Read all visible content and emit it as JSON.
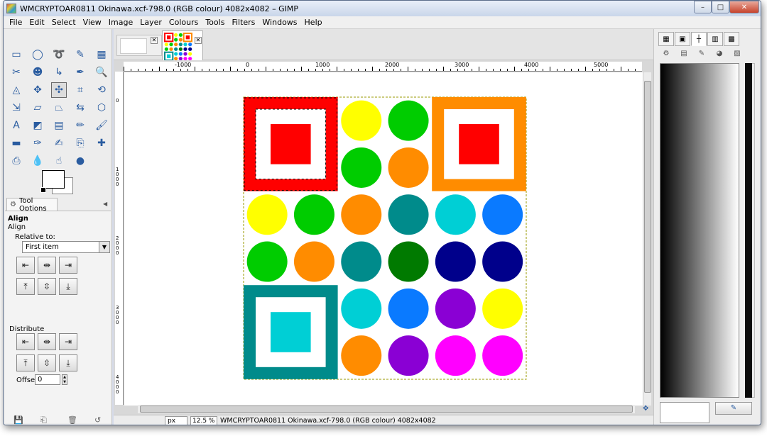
{
  "window": {
    "title": "WMCRYPTOAR0811 Okinawa.xcf-798.0 (RGB colour) 4082x4082 – GIMP",
    "minimize": "–",
    "maximize": "□",
    "close": "✕"
  },
  "menu": [
    "File",
    "Edit",
    "Select",
    "View",
    "Image",
    "Layer",
    "Colours",
    "Tools",
    "Filters",
    "Windows",
    "Help"
  ],
  "toolbox": {
    "tools": [
      {
        "name": "rect-select-icon",
        "glyph": "▭"
      },
      {
        "name": "ellipse-select-icon",
        "glyph": "◯"
      },
      {
        "name": "free-select-icon",
        "glyph": "➰"
      },
      {
        "name": "fuzzy-select-icon",
        "glyph": "✎"
      },
      {
        "name": "select-by-color-icon",
        "glyph": "▦"
      },
      {
        "name": "scissors-select-icon",
        "glyph": "✂"
      },
      {
        "name": "foreground-select-icon",
        "glyph": "☻"
      },
      {
        "name": "paths-icon",
        "glyph": "↳"
      },
      {
        "name": "color-picker-icon",
        "glyph": "✒"
      },
      {
        "name": "zoom-icon",
        "glyph": "🔍"
      },
      {
        "name": "measure-icon",
        "glyph": "◬"
      },
      {
        "name": "move-icon",
        "glyph": "✥"
      },
      {
        "name": "align-icon",
        "glyph": "✣"
      },
      {
        "name": "crop-icon",
        "glyph": "⌗"
      },
      {
        "name": "rotate-icon",
        "glyph": "⟲"
      },
      {
        "name": "scale-icon",
        "glyph": "⇲"
      },
      {
        "name": "shear-icon",
        "glyph": "▱"
      },
      {
        "name": "perspective-icon",
        "glyph": "⏢"
      },
      {
        "name": "flip-icon",
        "glyph": "⇆"
      },
      {
        "name": "cage-icon",
        "glyph": "⬡"
      },
      {
        "name": "text-icon",
        "glyph": "A"
      },
      {
        "name": "bucket-fill-icon",
        "glyph": "◩"
      },
      {
        "name": "blend-icon",
        "glyph": "▤"
      },
      {
        "name": "pencil-icon",
        "glyph": "✏"
      },
      {
        "name": "paintbrush-icon",
        "glyph": "🖌"
      },
      {
        "name": "eraser-icon",
        "glyph": "▬"
      },
      {
        "name": "airbrush-icon",
        "glyph": "✑"
      },
      {
        "name": "ink-icon",
        "glyph": "✍"
      },
      {
        "name": "clone-icon",
        "glyph": "⎘"
      },
      {
        "name": "heal-icon",
        "glyph": "✚"
      },
      {
        "name": "perspective-clone-icon",
        "glyph": "⎙"
      },
      {
        "name": "blur-icon",
        "glyph": "💧"
      },
      {
        "name": "smudge-icon",
        "glyph": "☝"
      },
      {
        "name": "dodge-burn-icon",
        "glyph": "●"
      }
    ],
    "active_tool": 12,
    "tab_label": "Tool Options",
    "options": {
      "title": "Align",
      "subtitle": "Align",
      "relative_label": "Relative to:",
      "relative_value": "First item",
      "distribute_label": "Distribute",
      "offset_label": "Offset:",
      "offset_value": "0",
      "align_buttons": [
        "⇤",
        "⇹",
        "⇥"
      ],
      "align_buttons_v": [
        "⤒",
        "⇳",
        "⤓"
      ]
    },
    "bottom_icons": [
      "💾",
      "⎗",
      "🗑",
      "↺"
    ]
  },
  "image_tabs": {
    "tab1_close": "✕",
    "tab2_close": "✕"
  },
  "rulers": {
    "h_labels": [
      "-1000",
      "0",
      "1000",
      "2000",
      "3000",
      "4000",
      "5000"
    ],
    "v_labels": [
      "0",
      "1000",
      "2000",
      "3000",
      "4000"
    ]
  },
  "statusbar": {
    "unit": "px",
    "zoom": "12.5 %",
    "text": "WMCRYPTOAR0811 Okinawa.xcf-798.0 (RGB colour) 4082x4082"
  },
  "colors": {
    "red": "#ff0000",
    "orange": "#ff8c00",
    "yellow": "#ffff00",
    "green": "#00cc00",
    "teal": "#008b8b",
    "dark_green": "#007a00",
    "cyan": "#00cfd5",
    "blue": "#0a7aff",
    "navy": "#00008b",
    "purple": "#8a00d4",
    "magenta": "#ff00ff",
    "white": "#ffffff"
  },
  "artwork": {
    "squares": [
      {
        "cell": [
          0,
          0
        ],
        "outer": "red",
        "inner": "red"
      },
      {
        "cell": [
          4,
          0
        ],
        "outer": "orange",
        "inner": "red"
      },
      {
        "cell": [
          0,
          4
        ],
        "outer": "teal",
        "inner": "cyan"
      }
    ],
    "circles": [
      {
        "col": 2,
        "row": 0,
        "color": "yellow"
      },
      {
        "col": 3,
        "row": 0,
        "color": "green"
      },
      {
        "col": 2,
        "row": 1,
        "color": "green"
      },
      {
        "col": 3,
        "row": 1,
        "color": "orange"
      },
      {
        "col": 0,
        "row": 2,
        "color": "yellow"
      },
      {
        "col": 1,
        "row": 2,
        "color": "green"
      },
      {
        "col": 2,
        "row": 2,
        "color": "orange"
      },
      {
        "col": 3,
        "row": 2,
        "color": "teal"
      },
      {
        "col": 4,
        "row": 2,
        "color": "cyan"
      },
      {
        "col": 5,
        "row": 2,
        "color": "blue"
      },
      {
        "col": 0,
        "row": 3,
        "color": "green"
      },
      {
        "col": 1,
        "row": 3,
        "color": "orange"
      },
      {
        "col": 2,
        "row": 3,
        "color": "teal"
      },
      {
        "col": 3,
        "row": 3,
        "color": "dark_green"
      },
      {
        "col": 4,
        "row": 3,
        "color": "navy"
      },
      {
        "col": 5,
        "row": 3,
        "color": "navy"
      },
      {
        "col": 2,
        "row": 4,
        "color": "cyan"
      },
      {
        "col": 3,
        "row": 4,
        "color": "blue"
      },
      {
        "col": 4,
        "row": 4,
        "color": "purple"
      },
      {
        "col": 5,
        "row": 4,
        "color": "yellow"
      },
      {
        "col": 2,
        "row": 5,
        "color": "orange"
      },
      {
        "col": 3,
        "row": 5,
        "color": "purple"
      },
      {
        "col": 4,
        "row": 5,
        "color": "magenta"
      },
      {
        "col": 5,
        "row": 5,
        "color": "magenta"
      }
    ]
  },
  "dock": {
    "top_tabs": [
      {
        "name": "brushes-tab-icon",
        "glyph": "▦"
      },
      {
        "name": "patterns-tab-icon",
        "glyph": "▣"
      },
      {
        "name": "paths-tab-icon",
        "glyph": "┼"
      },
      {
        "name": "gradients-tab-icon",
        "glyph": "▥"
      },
      {
        "name": "palettes-tab-icon",
        "glyph": "▩"
      }
    ],
    "second_tabs": [
      {
        "name": "tool-options-tab-icon",
        "glyph": "⚙"
      },
      {
        "name": "device-status-tab-icon",
        "glyph": "▤"
      },
      {
        "name": "brush-tab-icon",
        "glyph": "✎"
      },
      {
        "name": "color-tab-icon",
        "glyph": "◕"
      },
      {
        "name": "fonts-tab-icon",
        "glyph": "▨"
      }
    ],
    "button_glyph": "✎"
  }
}
